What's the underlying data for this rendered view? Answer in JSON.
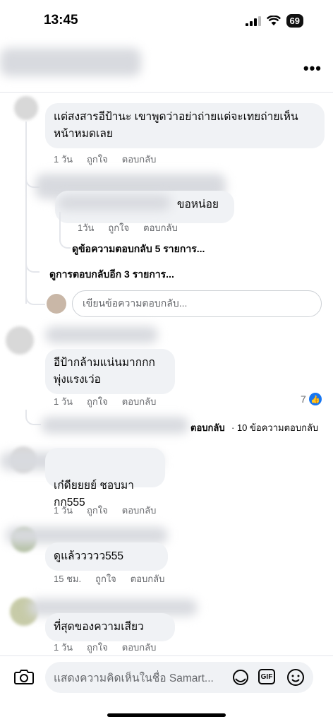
{
  "status_bar": {
    "time": "13:45",
    "battery": "69"
  },
  "header": {
    "more_label": "•••"
  },
  "comments": [
    {
      "text_line1": "แต่สงสารอีป้านะ เขาพูดว่าอย่าถ่ายแต่จะเทยถ่ายเห็น",
      "text_line2": "หน้าหมดเลย",
      "time": "1 วัน",
      "like": "ถูกใจ",
      "reply": "ตอบกลับ"
    },
    {
      "text_line1": "อีป้ากล้ามแน่นมากกก",
      "text_line2": "พุ่งแรงเว่อ",
      "time": "1 วัน",
      "like": "ถูกใจ",
      "reply": "ตอบกลับ",
      "like_count": "7"
    },
    {
      "text_line1": "เก๋ดียยยย์ ชอบมากก555",
      "time": "1 วัน",
      "like": "ถูกใจ",
      "reply": "ตอบกลับ"
    },
    {
      "text_line1": "ดูแล้ววววว555",
      "time": "15 ชม.",
      "like": "ถูกใจ",
      "reply": "ตอบกลับ"
    },
    {
      "text_line1": "ที่สุดของความเสียว",
      "time": "1 วัน",
      "like": "ถูกใจ",
      "reply": "ตอบกลับ"
    }
  ],
  "nested_reply": {
    "text": "ขอหน่อย",
    "time": "1วัน",
    "like": "ถูกใจ",
    "reply": "ตอบกลับ",
    "view_more": "ดูข้อความตอบกลับ 5 รายการ..."
  },
  "view_more_replies": "ดูการตอบกลับอีก 3 รายการ...",
  "reply_placeholder": "เขียนข้อความตอบกลับ...",
  "collapsed_thread": {
    "prefix": "ตอบกลับ",
    "count": "· 10 ข้อความตอบกลับ"
  },
  "composer": {
    "placeholder": "แสดงความคิดเห็นในชื่อ Samart...",
    "gif_label": "GIF"
  }
}
